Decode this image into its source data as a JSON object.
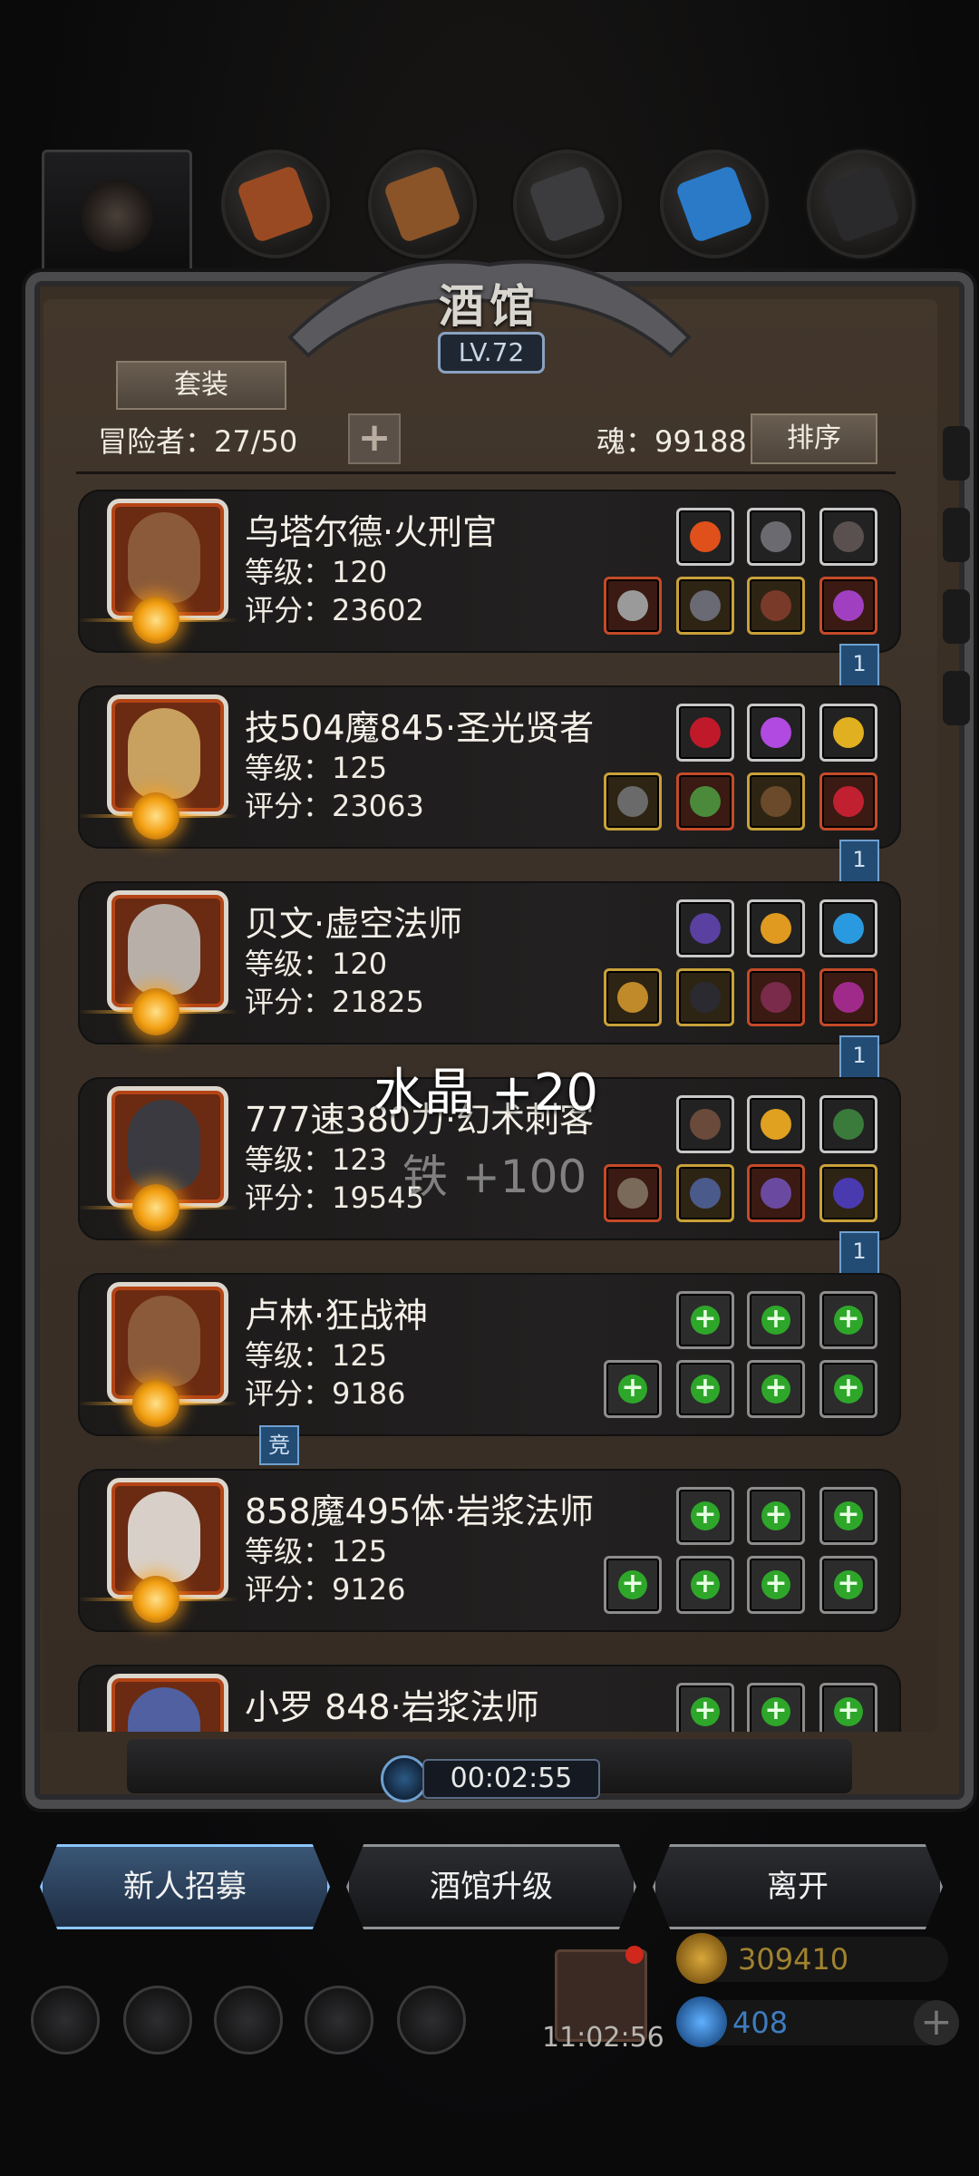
{
  "header": {
    "title": "酒馆",
    "level": "LV.72"
  },
  "toolbar": {
    "suit_label": "套装",
    "adventurers": "冒险者：27/50",
    "add_label": "+",
    "soul": "魂：99188",
    "sort_label": "排序"
  },
  "heroes": [
    {
      "name": "乌塔尔德·火刑官",
      "level": "等级：120",
      "score": "评分：23602",
      "face": "#8a5a3a",
      "bookmark": "1"
    },
    {
      "name": "技504魔845·圣光贤者",
      "level": "等级：125",
      "score": "评分：23063",
      "face": "#c8a060",
      "bookmark": "1"
    },
    {
      "name": "贝文·虚空法师",
      "level": "等级：120",
      "score": "评分：21825",
      "face": "#b8b0a8",
      "bookmark": "1"
    },
    {
      "name": "777速380力·幻术刺客",
      "level": "等级：123",
      "score": "评分：19545",
      "face": "#3a3a40",
      "bookmark": "1"
    },
    {
      "name": "卢林·狂战神",
      "level": "等级：125",
      "score": "评分：9186",
      "face": "#8a5a3a",
      "badge": "竞"
    },
    {
      "name": "858魔495体·岩浆法师",
      "level": "等级：125",
      "score": "评分：9126",
      "face": "#d8d0c8"
    },
    {
      "name": "小罗 848·岩浆法师",
      "level": "",
      "score": "",
      "face": "#5060a0"
    }
  ],
  "floating": {
    "crystal": "水晶 +20",
    "iron": "铁 +100"
  },
  "timer": "00:02:55",
  "buttons": {
    "recruit": "新人招募",
    "upgrade": "酒馆升级",
    "leave": "离开"
  },
  "gift_timer": "11:02:56",
  "currency": {
    "gold": "309410",
    "gems": "408"
  },
  "colors": {
    "accent_blue": "#8cc6ff",
    "card_bg": "#1f1d1c",
    "frame": "#3b3128",
    "plus_green": "#2ea62a"
  }
}
